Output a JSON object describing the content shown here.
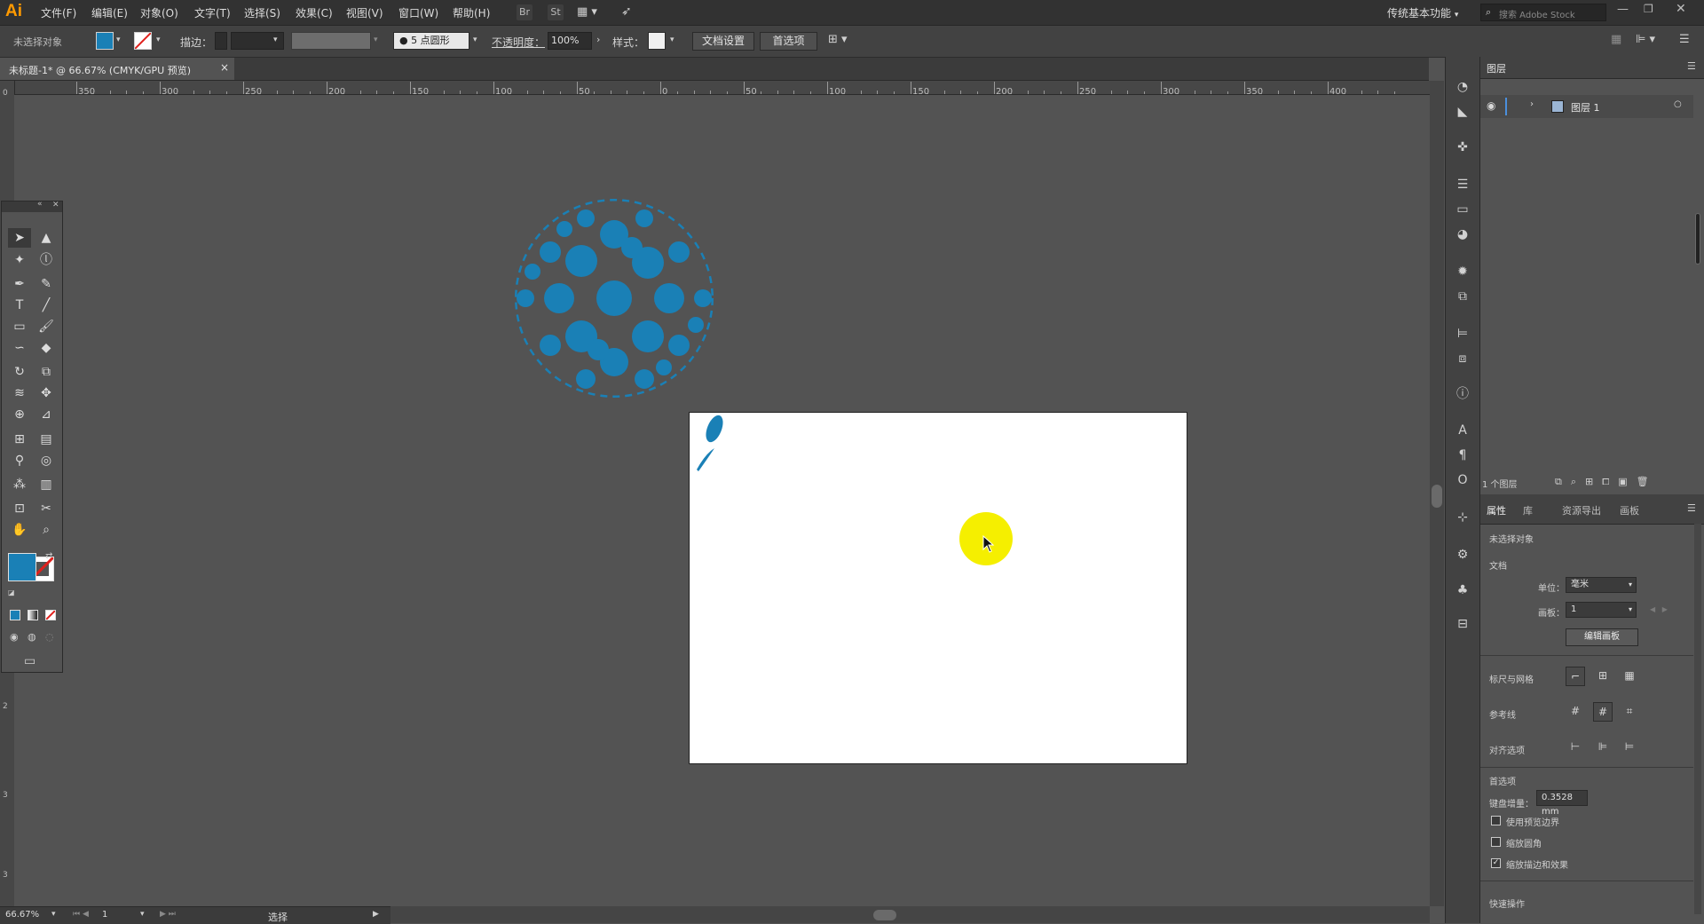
{
  "app": {
    "logo": "Ai"
  },
  "menu": [
    "文件(F)",
    "编辑(E)",
    "对象(O)",
    "文字(T)",
    "选择(S)",
    "效果(C)",
    "视图(V)",
    "窗口(W)",
    "帮助(H)"
  ],
  "menubar_icons": {
    "br": "Br",
    "st": "St"
  },
  "workspace": "传统基本功能",
  "search_placeholder": "搜索 Adobe Stock",
  "control": {
    "no_selection": "未选择对象",
    "stroke_label": "描边：",
    "brush": "5 点圆形",
    "opacity_label": "不透明度：",
    "opacity": "100%",
    "style_label": "样式：",
    "doc_setup": "文档设置",
    "prefs": "首选项"
  },
  "doc_tab": {
    "title": "未标题-1* @ 66.67% (CMYK/GPU 预览)",
    "close": "×"
  },
  "ruler_h_labels": [
    "350",
    "300",
    "250",
    "200",
    "150",
    "100",
    "50",
    "0",
    "50",
    "100",
    "150",
    "200",
    "250",
    "300",
    "350",
    "400"
  ],
  "ruler_v_labels": [
    "0",
    "2",
    "3",
    "3"
  ],
  "status": {
    "zoom": "66.67%",
    "page": "1",
    "tool": "选择"
  },
  "colors": {
    "accent": "#1a80b6",
    "cursor_highlight": "#f5ef00",
    "panel": "#535353"
  },
  "layers": {
    "title": "图层",
    "layer_name": "图层 1",
    "count": "1 个图层"
  },
  "props": {
    "tabs": [
      "属性",
      "库",
      "资源导出",
      "画板"
    ],
    "no_selection": "未选择对象",
    "doc_section": "文档",
    "unit_label": "单位：",
    "unit_value": "毫米",
    "artboard_label": "画板：",
    "artboard_value": "1",
    "edit_artboard": "编辑画板",
    "rulers_grids": "标尺与网格",
    "guides": "参考线",
    "align_options": "对齐选项",
    "prefs_section": "首选项",
    "keyboard_inc_label": "键盘增量：",
    "keyboard_inc_value": "0.3528 mm",
    "cb_preview_bounds": "使用预览边界",
    "cb_scale_corners": "缩放圆角",
    "cb_scale_strokes": "缩放描边和效果",
    "quick_actions": "快速操作"
  }
}
